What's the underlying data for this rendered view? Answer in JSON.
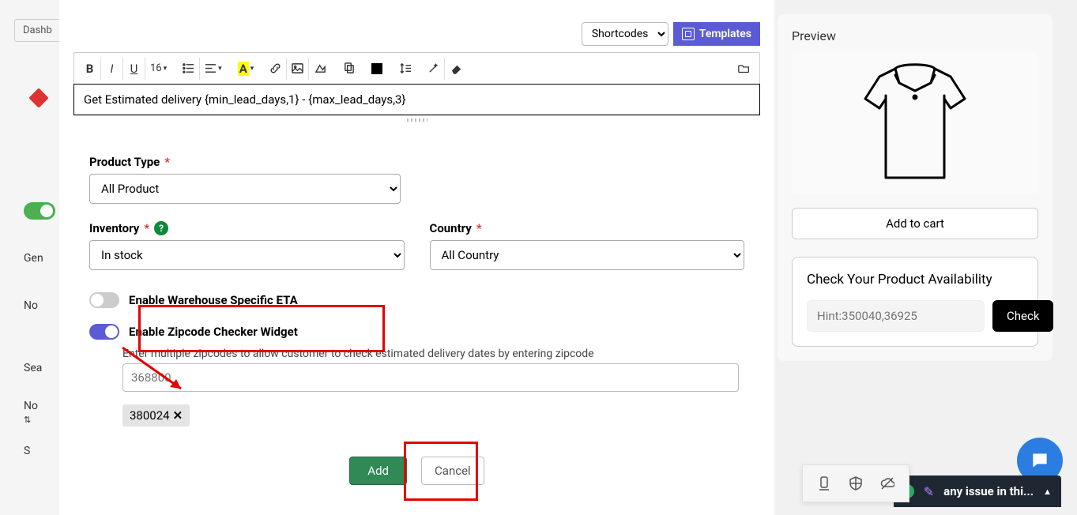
{
  "background": {
    "dash_tab": "Dashb",
    "gen": "Gen",
    "no": "No",
    "sea": "Sea",
    "no2": "No",
    "sort": "⇅",
    "so": "S"
  },
  "top": {
    "shortcodes": "Shortcodes",
    "templates": "Templates"
  },
  "editor": {
    "content": "Get Estimated delivery {min_lead_days,1} - {max_lead_days,3}",
    "font_size": "16"
  },
  "form": {
    "product_type_label": "Product Type",
    "product_type_value": "All Product",
    "inventory_label": "Inventory",
    "inventory_value": "In stock",
    "country_label": "Country",
    "country_value": "All Country",
    "warehouse_toggle": "Enable Warehouse Specific ETA",
    "zipcode_toggle": "Enable Zipcode Checker Widget",
    "zipcode_hint": "Enter multiple zipcodes to allow customer to check estimated delivery dates by entering zipcode",
    "zipcode_placeholder": "368800",
    "zipcode_tag": "380024",
    "add": "Add",
    "cancel": "Cancel"
  },
  "preview": {
    "title": "Preview",
    "add_to_cart": "Add to cart",
    "avail_title": "Check Your Product Availability",
    "avail_placeholder": "Hint:350040,36925",
    "check": "Check"
  },
  "bottombar": {
    "text": "any issue in thi..."
  }
}
